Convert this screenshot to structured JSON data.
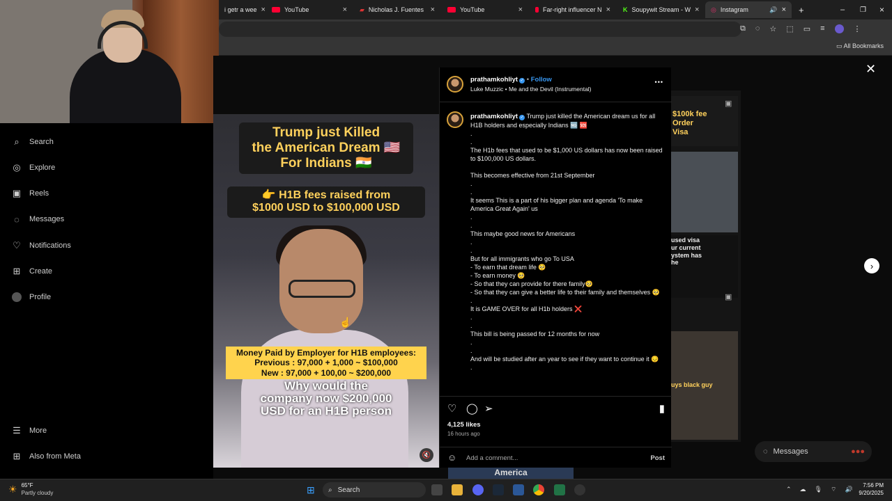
{
  "browser": {
    "tabs": [
      {
        "label": "i getr a wee",
        "active": false,
        "icon": "page-icon"
      },
      {
        "label": "YouTube",
        "active": false,
        "icon": "youtube-icon"
      },
      {
        "label": "Nicholas J. Fuentes",
        "active": false,
        "icon": "flag-icon"
      },
      {
        "label": "YouTube",
        "active": false,
        "icon": "youtube-icon"
      },
      {
        "label": "Far-right influencer N",
        "active": false,
        "icon": "youtube-icon"
      },
      {
        "label": "Soupywit Stream - W",
        "active": false,
        "icon": "kick-icon"
      },
      {
        "label": "Instagram",
        "active": true,
        "icon": "instagram-icon"
      }
    ],
    "new_tab": "+",
    "bookmarks_label": "All Bookmarks"
  },
  "nav": {
    "items": [
      {
        "label": "Search",
        "icon": "search-icon"
      },
      {
        "label": "Explore",
        "icon": "compass-icon"
      },
      {
        "label": "Reels",
        "icon": "reels-icon"
      },
      {
        "label": "Messages",
        "icon": "messenger-icon"
      },
      {
        "label": "Notifications",
        "icon": "heart-icon"
      },
      {
        "label": "Create",
        "icon": "plus-square-icon"
      },
      {
        "label": "Profile",
        "icon": "avatar-icon"
      }
    ],
    "more": "More",
    "also": "Also from Meta"
  },
  "video": {
    "title_lines": [
      "Trump just Killed",
      "the American Dream 🇺🇸",
      "For Indians 🇮🇳"
    ],
    "fees_lines": [
      "👉 H1B fees raised from",
      "$1000 USD to $100,000 USD"
    ],
    "paid_lines": [
      "Money Paid by Employer for H1B employees:",
      "Previous : 97,000 + 1,000 ~ $100,000",
      "New : 97,000 + 100,00 ~ $200,000"
    ],
    "question_lines": [
      "Why would the",
      "company now $200,000",
      "USD for an H1B person"
    ]
  },
  "post": {
    "username": "prathamkohliyt",
    "follow": "Follow",
    "audio": "Luke Muzzic • Me and the Devil (Instrumental)",
    "more": "•••",
    "caption_lines": [
      "Trump just killed the American dream us for all H1B holders and especially Indians 🆖 🆘",
      ".",
      ".",
      "The H1b fees that used to be $1,000 US dollars has now been raised to $100,000 US dollars.",
      "",
      "This becomes effective from 21st September",
      ".",
      ".",
      "It seems This is a part of his bigger plan and agenda 'To make America Great Again' us",
      ".",
      ".",
      "This maybe good news for Americans",
      ".",
      ".",
      "But for all immigrants who go To USA",
      "- To earn that dream life 🥺",
      "- To earn money 🥺",
      "- So that they can provide for there family🥺",
      "- So that they can give a better life to their family and themselves 🥺",
      ".",
      "It is GAME OVER for all H1b holders ❌",
      ".",
      ".",
      "This bill is being passed for 12 months for now",
      ".",
      ".",
      "And will be studied after an year to see if they want to continue it 😔",
      "."
    ],
    "likes": "4,125 likes",
    "time": "16 hours ago",
    "comment_placeholder": "Add a comment...",
    "post_button": "Post"
  },
  "side": {
    "messages": "Messages",
    "thumb_text_1": "$100k fee\nOrder\nVisa",
    "thumb_text_2": "used visa\nur current\nystem has\nhe",
    "thumb_text_3": "uys black guy",
    "bottom_text": "America"
  },
  "taskbar": {
    "weather_temp": "65°F",
    "weather_desc": "Partly cloudy",
    "search": "Search",
    "time": "7:56 PM",
    "date": "9/20/2025"
  },
  "colors": {
    "accent": "#3897f0",
    "yellow": "#ffd34d",
    "ring": "#d8a23a"
  }
}
